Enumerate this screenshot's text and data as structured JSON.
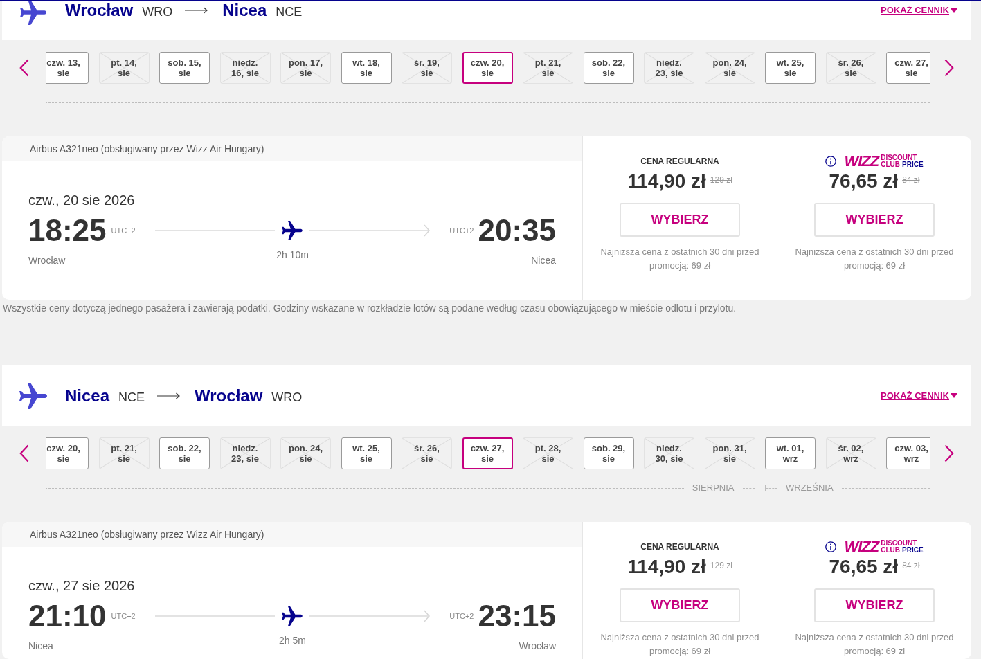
{
  "sections": [
    {
      "route": {
        "origin_city": "Wrocław",
        "origin_code": "WRO",
        "destination_city": "Nicea",
        "destination_code": "NCE"
      },
      "price_list_link": "POKAŻ CENNIK",
      "date_groups": [
        {
          "dates": [
            {
              "label": "czw. 13, sie",
              "available": true,
              "selected": false
            },
            {
              "label": "pt. 14, sie",
              "available": false,
              "selected": false
            },
            {
              "label": "sob. 15, sie",
              "available": true,
              "selected": false
            },
            {
              "label": "niedz. 16, sie",
              "available": false,
              "selected": false
            },
            {
              "label": "pon. 17, sie",
              "available": false,
              "selected": false
            },
            {
              "label": "wt. 18, sie",
              "available": true,
              "selected": false
            },
            {
              "label": "śr. 19, sie",
              "available": false,
              "selected": false
            },
            {
              "label": "czw. 20, sie",
              "available": true,
              "selected": true
            },
            {
              "label": "pt. 21, sie",
              "available": false,
              "selected": false
            },
            {
              "label": "sob. 22, sie",
              "available": true,
              "selected": false
            },
            {
              "label": "niedz. 23, sie",
              "available": false,
              "selected": false
            },
            {
              "label": "pon. 24, sie",
              "available": false,
              "selected": false
            },
            {
              "label": "wt. 25, sie",
              "available": true,
              "selected": false
            },
            {
              "label": "śr. 26, sie",
              "available": false,
              "selected": false
            },
            {
              "label": "czw. 27, sie",
              "available": true,
              "selected": false
            }
          ]
        }
      ],
      "flight": {
        "aircraft": "Airbus A321neo (obsługiwany przez Wizz Air Hungary)",
        "date": "czw., 20 sie 2026",
        "departure_time": "18:25",
        "departure_tz": "UTC+2",
        "departure_city": "Wrocław",
        "duration": "2h 10m",
        "arrival_tz": "UTC+2",
        "arrival_time": "20:35",
        "arrival_city": "Nicea"
      },
      "fares": [
        {
          "kind": "regular",
          "title": "CENA REGULARNA",
          "price": "114,90 zł",
          "old_price": "129 zł",
          "button": "WYBIERZ",
          "note": "Najniższa cena z ostatnich 30 dni przed promocją: 69 zł"
        },
        {
          "kind": "club",
          "logo": {
            "wordmark": "WIZZ",
            "words": [
              {
                "text": "DISCOUNT",
                "color": "#c6007e"
              },
              {
                "text": "CLUB",
                "color": "#c6007e"
              },
              {
                "text": "PRICE",
                "color": "#06038d"
              }
            ]
          },
          "price": "76,65 zł",
          "old_price": "84 zł",
          "button": "WYBIERZ",
          "note": "Najniższa cena z ostatnich 30 dni przed promocją: 69 zł"
        }
      ],
      "footnote": "Wszystkie ceny dotyczą jednego pasażera i zawierają podatki. Godziny wskazane w rozkładzie lotów są podane według czasu obowiązującego w mieście odlotu i przylotu."
    },
    {
      "route": {
        "origin_city": "Nicea",
        "origin_code": "NCE",
        "destination_city": "Wrocław",
        "destination_code": "WRO"
      },
      "price_list_link": "POKAŻ CENNIK",
      "date_groups": [
        {
          "label": "SIERPNIA",
          "dates": [
            {
              "label": "czw. 20, sie",
              "available": true,
              "selected": false
            },
            {
              "label": "pt. 21, sie",
              "available": false,
              "selected": false
            },
            {
              "label": "sob. 22, sie",
              "available": true,
              "selected": false
            },
            {
              "label": "niedz. 23, sie",
              "available": false,
              "selected": false
            },
            {
              "label": "pon. 24, sie",
              "available": false,
              "selected": false
            },
            {
              "label": "wt. 25, sie",
              "available": true,
              "selected": false
            },
            {
              "label": "śr. 26, sie",
              "available": false,
              "selected": false
            },
            {
              "label": "czw. 27, sie",
              "available": true,
              "selected": true
            },
            {
              "label": "pt. 28, sie",
              "available": false,
              "selected": false
            },
            {
              "label": "sob. 29, sie",
              "available": true,
              "selected": false
            },
            {
              "label": "niedz. 30, sie",
              "available": false,
              "selected": false
            },
            {
              "label": "pon. 31, sie",
              "available": false,
              "selected": false
            }
          ]
        },
        {
          "label": "WRZEŚNIA",
          "dates": [
            {
              "label": "wt. 01, wrz",
              "available": true,
              "selected": false
            },
            {
              "label": "śr. 02, wrz",
              "available": false,
              "selected": false
            },
            {
              "label": "czw. 03, wrz",
              "available": true,
              "selected": false
            }
          ]
        }
      ],
      "flight": {
        "aircraft": "Airbus A321neo (obsługiwany przez Wizz Air Hungary)",
        "date": "czw., 27 sie 2026",
        "departure_time": "21:10",
        "departure_tz": "UTC+2",
        "departure_city": "Nicea",
        "duration": "2h 5m",
        "arrival_tz": "UTC+2",
        "arrival_time": "23:15",
        "arrival_city": "Wrocław"
      },
      "fares": [
        {
          "kind": "regular",
          "title": "CENA REGULARNA",
          "price": "114,90 zł",
          "old_price": "129 zł",
          "button": "WYBIERZ",
          "note": "Najniższa cena z ostatnich 30 dni przed promocją: 69 zł"
        },
        {
          "kind": "club",
          "logo": {
            "wordmark": "WIZZ",
            "words": [
              {
                "text": "DISCOUNT",
                "color": "#c6007e"
              },
              {
                "text": "CLUB",
                "color": "#c6007e"
              },
              {
                "text": "PRICE",
                "color": "#06038d"
              }
            ]
          },
          "price": "76,65 zł",
          "old_price": "84 zł",
          "button": "WYBIERZ",
          "note": "Najniższa cena z ostatnich 30 dni przed promocją: 69 zł"
        }
      ]
    }
  ]
}
